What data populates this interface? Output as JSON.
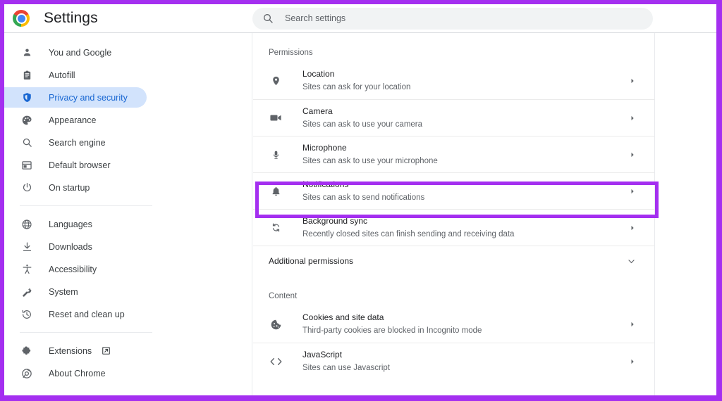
{
  "window": {
    "highlight_color": "#a42ff0",
    "accent_color": "#1967d2",
    "selected_bg": "#d2e3fc"
  },
  "header": {
    "logo_icon": "chrome-logo-icon",
    "title": "Settings",
    "search": {
      "icon": "search-icon",
      "placeholder": "Search settings",
      "value": ""
    }
  },
  "sidebar": {
    "groups": [
      {
        "items": [
          {
            "icon": "person-icon",
            "label": "You and Google",
            "selected": false
          },
          {
            "icon": "autofill-icon",
            "label": "Autofill",
            "selected": false
          },
          {
            "icon": "shield-icon",
            "label": "Privacy and security",
            "selected": true
          },
          {
            "icon": "palette-icon",
            "label": "Appearance",
            "selected": false
          },
          {
            "icon": "search-icon",
            "label": "Search engine",
            "selected": false
          },
          {
            "icon": "browser-icon",
            "label": "Default browser",
            "selected": false
          },
          {
            "icon": "power-icon",
            "label": "On startup",
            "selected": false
          }
        ]
      },
      {
        "items": [
          {
            "icon": "globe-icon",
            "label": "Languages",
            "selected": false
          },
          {
            "icon": "download-icon",
            "label": "Downloads",
            "selected": false
          },
          {
            "icon": "accessibility-icon",
            "label": "Accessibility",
            "selected": false
          },
          {
            "icon": "wrench-icon",
            "label": "System",
            "selected": false
          },
          {
            "icon": "restore-icon",
            "label": "Reset and clean up",
            "selected": false
          }
        ]
      },
      {
        "items": [
          {
            "icon": "puzzle-icon",
            "label": "Extensions",
            "selected": false,
            "external": true,
            "external_icon": "open-in-new-icon"
          },
          {
            "icon": "chrome-outline-icon",
            "label": "About Chrome",
            "selected": false,
            "external": false
          }
        ]
      }
    ]
  },
  "main": {
    "sections": [
      {
        "header": "Permissions",
        "rows": [
          {
            "icon": "location-pin-icon",
            "title": "Location",
            "subtitle": "Sites can ask for your location",
            "arrow": "chevron-right-icon",
            "highlighted": false
          },
          {
            "icon": "camera-icon",
            "title": "Camera",
            "subtitle": "Sites can ask to use your camera",
            "arrow": "chevron-right-icon",
            "highlighted": false
          },
          {
            "icon": "microphone-icon",
            "title": "Microphone",
            "subtitle": "Sites can ask to use your microphone",
            "arrow": "chevron-right-icon",
            "highlighted": false
          },
          {
            "icon": "bell-icon",
            "title": "Notifications",
            "subtitle": "Sites can ask to send notifications",
            "arrow": "chevron-right-icon",
            "highlighted": true
          },
          {
            "icon": "sync-icon",
            "title": "Background sync",
            "subtitle": "Recently closed sites can finish sending and receiving data",
            "arrow": "chevron-right-icon",
            "highlighted": false
          }
        ],
        "expander": {
          "title": "Additional permissions",
          "arrow": "chevron-down-icon"
        }
      },
      {
        "header": "Content",
        "rows": [
          {
            "icon": "cookie-icon",
            "title": "Cookies and site data",
            "subtitle": "Third-party cookies are blocked in Incognito mode",
            "arrow": "chevron-right-icon",
            "highlighted": false
          },
          {
            "icon": "code-icon",
            "title": "JavaScript",
            "subtitle": "Sites can use Javascript",
            "arrow": "chevron-right-icon",
            "highlighted": false
          }
        ]
      }
    ]
  }
}
